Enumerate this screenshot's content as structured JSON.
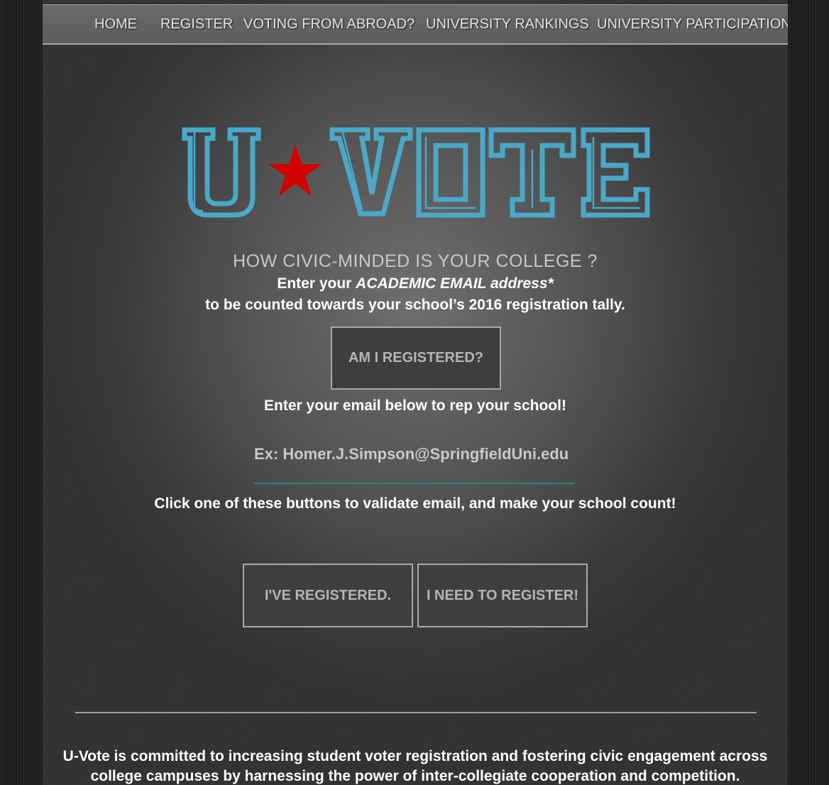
{
  "nav": {
    "items": [
      {
        "label": "HOME"
      },
      {
        "label": "REGISTER"
      },
      {
        "label": "VOTING FROM ABROAD?"
      },
      {
        "label": "UNIVERSITY RANKINGS"
      },
      {
        "label": "UNIVERSITY PARTICIPATION"
      }
    ]
  },
  "logo": {
    "text_left": "U",
    "text_right": "VOTE",
    "color": "#4aa8c8",
    "star_color": "#d00000"
  },
  "hero": {
    "headline": "HOW CIVIC-MINDED IS YOUR COLLEGE ?",
    "line1_prefix": "Enter your ",
    "line1_emphasis": "ACADEMIC EMAIL address*",
    "line2": "to be counted towards your school’s 2016 registration tally.",
    "check_button": "AM I REGISTERED?",
    "rep_prompt": "Enter your email below to rep your school!",
    "email_placeholder": "Ex: Homer.J.Simpson@SpringfieldUni.edu",
    "validate_prompt": "Click one of these buttons to validate email, and make your school count!",
    "registered_button": "I'VE REGISTERED.",
    "need_register_button": "I NEED TO REGISTER!"
  },
  "footer": {
    "mission_line1": "U-Vote is committed to increasing student voter registration and fostering civic engagement across",
    "mission_line2": "college campuses by harnessing the power of inter-collegiate cooperation and competition."
  },
  "colors": {
    "accent": "#4aa8c8",
    "star": "#d00000",
    "button_border": "#a8a8a8"
  }
}
